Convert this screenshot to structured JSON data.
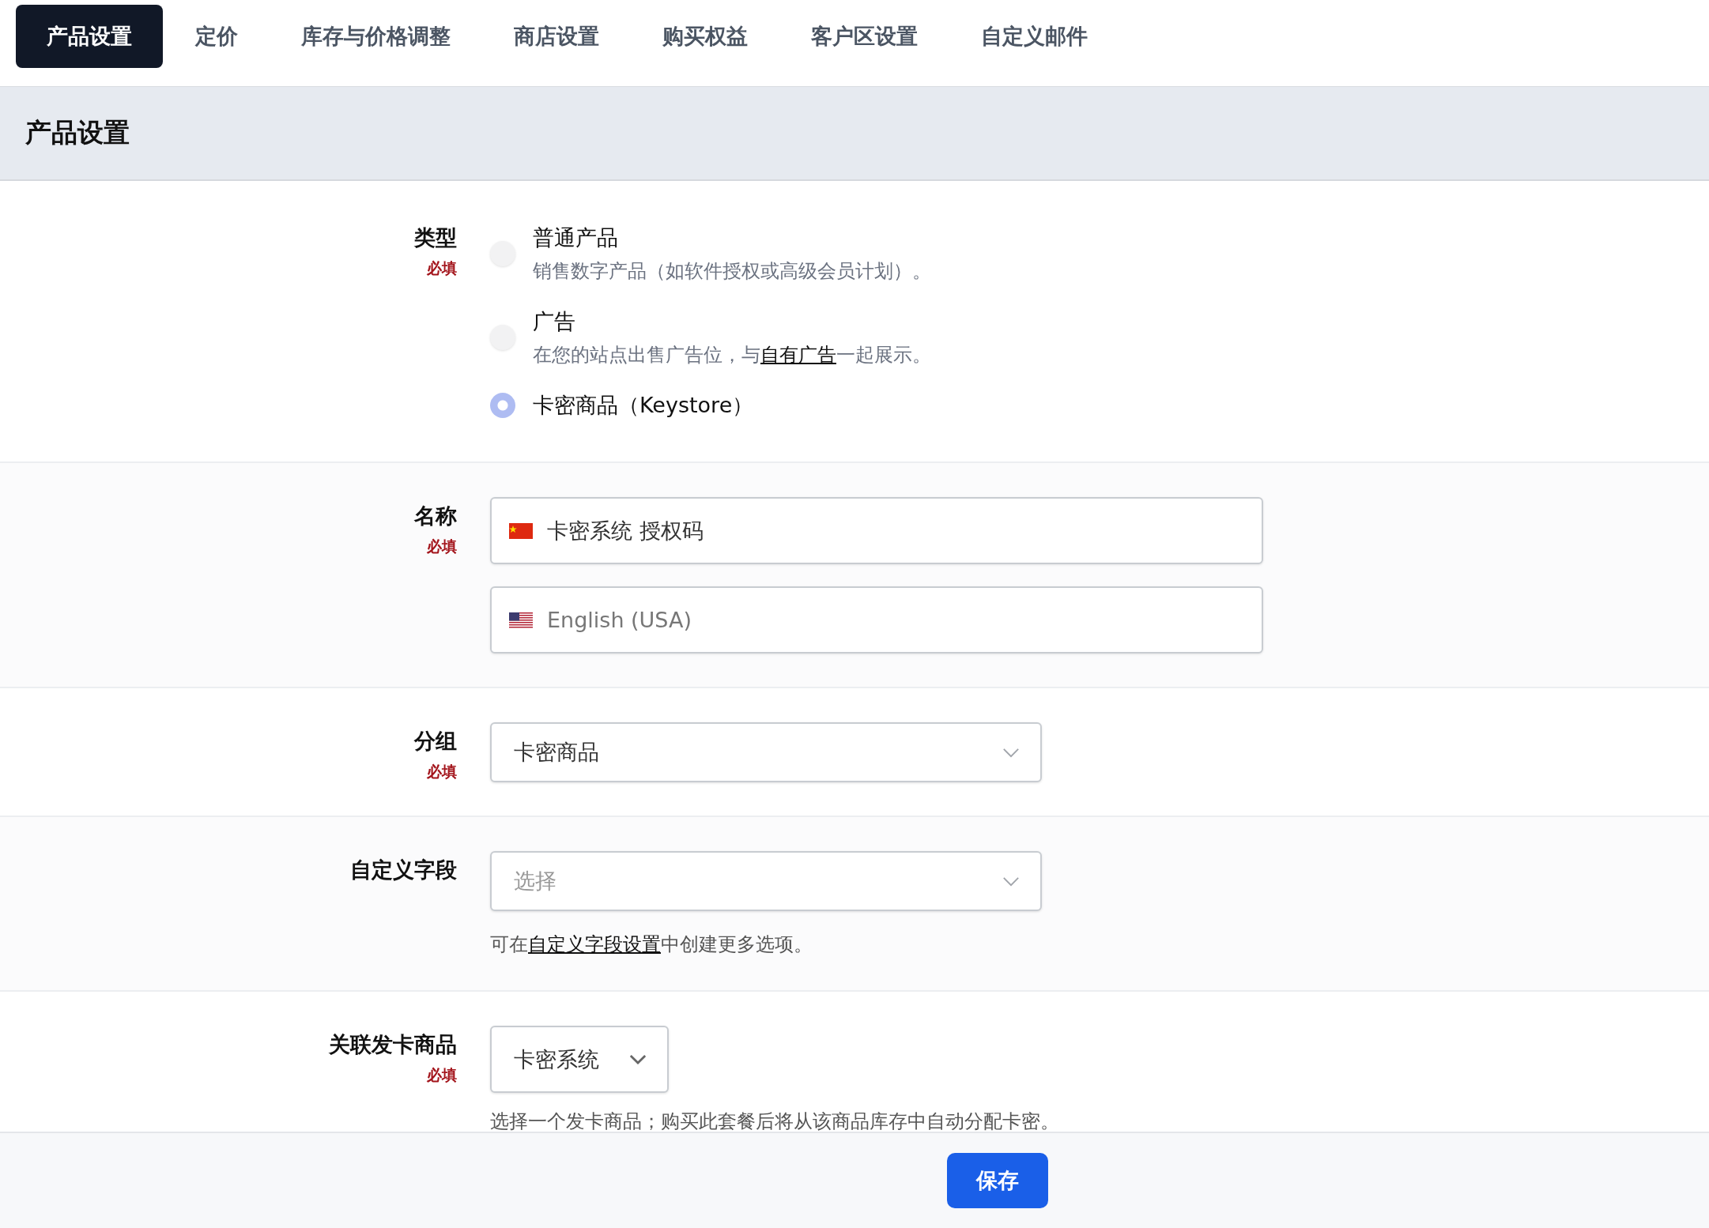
{
  "tabs": [
    {
      "label": "产品设置",
      "selected": true
    },
    {
      "label": "定价",
      "selected": false
    },
    {
      "label": "库存与价格调整",
      "selected": false
    },
    {
      "label": "商店设置",
      "selected": false
    },
    {
      "label": "购买权益",
      "selected": false
    },
    {
      "label": "客户区设置",
      "selected": false
    },
    {
      "label": "自定义邮件",
      "selected": false
    }
  ],
  "section_title": "产品设置",
  "fields": [
    {
      "kind": "radio",
      "label": "类型",
      "required_note": "必填",
      "options": [
        {
          "title": "普通产品",
          "selected": false,
          "description": [
            {
              "kind": "text",
              "text": "销售数字产品（如软件授权或高级会员计划）。"
            }
          ]
        },
        {
          "title": "广告",
          "selected": false,
          "description": [
            {
              "kind": "text",
              "text": "在您的站点出售广告位，与"
            },
            {
              "kind": "link",
              "text": "自有广告"
            },
            {
              "kind": "text",
              "text": "一起展示。"
            }
          ]
        },
        {
          "title": "卡密商品（Keystore）",
          "selected": true
        }
      ]
    },
    {
      "kind": "translations",
      "label": "名称",
      "required_note": "必填",
      "inputs": [
        {
          "kind": "cn",
          "value": "卡密系统 授权码"
        },
        {
          "kind": "us",
          "placeholder": "English (USA)"
        }
      ]
    },
    {
      "kind": "select",
      "label": "分组",
      "required_note": "必填",
      "value": "卡密商品"
    },
    {
      "kind": "select",
      "label": "自定义字段",
      "placeholder": "选择",
      "help": [
        {
          "kind": "text",
          "text": "可在"
        },
        {
          "kind": "link",
          "text": "自定义字段设置"
        },
        {
          "kind": "text",
          "text": "中创建更多选项。"
        }
      ]
    },
    {
      "kind": "short_select",
      "label": "关联发卡商品",
      "required_note": "必填",
      "value": "卡密系统",
      "help": [
        {
          "kind": "text",
          "text": "选择一个发卡商品；购买此套餐后将从该商品库存中自动分配卡密。"
        }
      ]
    }
  ],
  "save_button": "保存"
}
